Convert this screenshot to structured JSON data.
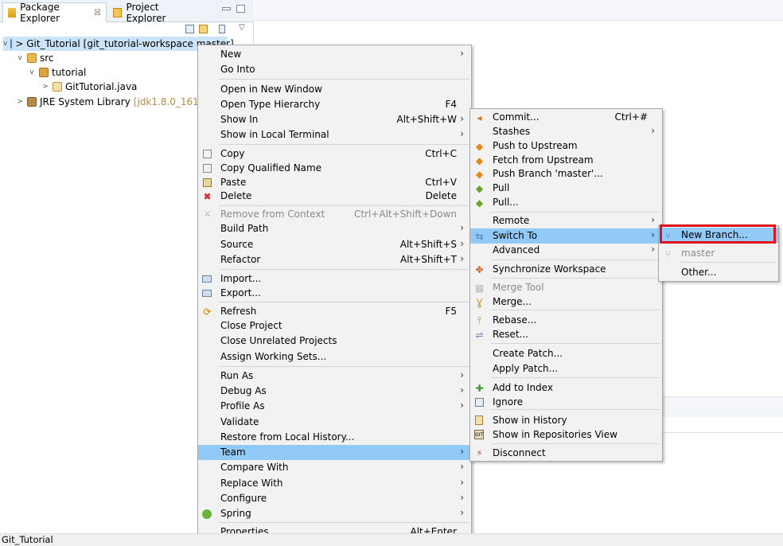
{
  "explorer": {
    "tabs": [
      {
        "label": "Package Explorer",
        "close": "☒"
      },
      {
        "label": "Project Explorer"
      }
    ],
    "tree": [
      {
        "label": "> Git_Tutorial",
        "extra": "[git_tutorial-workspace master]"
      },
      {
        "label": "src"
      },
      {
        "label": "tutorial"
      },
      {
        "label": "GitTutorial.java"
      },
      {
        "label": "JRE System Library",
        "extra": "[jdk1.8.0_161]"
      }
    ]
  },
  "context_menu": {
    "items": [
      {
        "label": "New",
        "shortcut": "",
        "arrow": "›"
      },
      {
        "label": "Go Into",
        "shortcut": ""
      },
      {
        "label": "Open in New Window",
        "shortcut": ""
      },
      {
        "label": "Open Type Hierarchy",
        "shortcut": "F4"
      },
      {
        "label": "Show In",
        "shortcut": "Alt+Shift+W",
        "arrow": "›"
      },
      {
        "label": "Show in Local Terminal",
        "shortcut": "",
        "arrow": "›"
      },
      {
        "label": "Copy",
        "shortcut": "Ctrl+C"
      },
      {
        "label": "Copy Qualified Name",
        "shortcut": ""
      },
      {
        "label": "Paste",
        "shortcut": "Ctrl+V"
      },
      {
        "label": "Delete",
        "shortcut": "Delete"
      },
      {
        "label": "Remove from Context",
        "shortcut": "Ctrl+Alt+Shift+Down"
      },
      {
        "label": "Build Path",
        "shortcut": "",
        "arrow": "›"
      },
      {
        "label": "Source",
        "shortcut": "Alt+Shift+S",
        "arrow": "›"
      },
      {
        "label": "Refactor",
        "shortcut": "Alt+Shift+T",
        "arrow": "›"
      },
      {
        "label": "Import...",
        "shortcut": ""
      },
      {
        "label": "Export...",
        "shortcut": ""
      },
      {
        "label": "Refresh",
        "shortcut": "F5"
      },
      {
        "label": "Close Project",
        "shortcut": ""
      },
      {
        "label": "Close Unrelated Projects",
        "shortcut": ""
      },
      {
        "label": "Assign Working Sets...",
        "shortcut": ""
      },
      {
        "label": "Run As",
        "shortcut": "",
        "arrow": "›"
      },
      {
        "label": "Debug As",
        "shortcut": "",
        "arrow": "›"
      },
      {
        "label": "Profile As",
        "shortcut": "",
        "arrow": "›"
      },
      {
        "label": "Validate",
        "shortcut": ""
      },
      {
        "label": "Restore from Local History...",
        "shortcut": ""
      },
      {
        "label": "Team",
        "shortcut": "",
        "arrow": "›"
      },
      {
        "label": "Compare With",
        "shortcut": "",
        "arrow": "›"
      },
      {
        "label": "Replace With",
        "shortcut": "",
        "arrow": "›"
      },
      {
        "label": "Configure",
        "shortcut": "",
        "arrow": "›"
      },
      {
        "label": "Spring",
        "shortcut": "",
        "arrow": "›"
      },
      {
        "label": "Properties",
        "shortcut": "Alt+Enter"
      }
    ]
  },
  "team_menu": {
    "items": [
      {
        "label": "Commit...",
        "shortcut": "Ctrl+#"
      },
      {
        "label": "Stashes",
        "arrow": "›"
      },
      {
        "label": "Push to Upstream"
      },
      {
        "label": "Fetch from Upstream"
      },
      {
        "label": "Push Branch 'master'..."
      },
      {
        "label": "Pull"
      },
      {
        "label": "Pull..."
      },
      {
        "label": "Remote",
        "arrow": "›"
      },
      {
        "label": "Switch To",
        "arrow": "›"
      },
      {
        "label": "Advanced",
        "arrow": "›"
      },
      {
        "label": "Synchronize Workspace"
      },
      {
        "label": "Merge Tool"
      },
      {
        "label": "Merge..."
      },
      {
        "label": "Rebase..."
      },
      {
        "label": "Reset..."
      },
      {
        "label": "Create Patch..."
      },
      {
        "label": "Apply Patch..."
      },
      {
        "label": "Add to Index"
      },
      {
        "label": "Ignore"
      },
      {
        "label": "Show in History"
      },
      {
        "label": "Show in Repositories View"
      },
      {
        "label": "Disconnect"
      }
    ]
  },
  "switch_menu": {
    "items": [
      {
        "label": "New Branch..."
      },
      {
        "label": "master"
      },
      {
        "label": "Other..."
      }
    ]
  },
  "status": {
    "text": "Git_Tutorial"
  },
  "colors": {
    "highlight": "#91c9f7",
    "selected_tree": "#cce4f7",
    "callout": "#e0121b"
  }
}
